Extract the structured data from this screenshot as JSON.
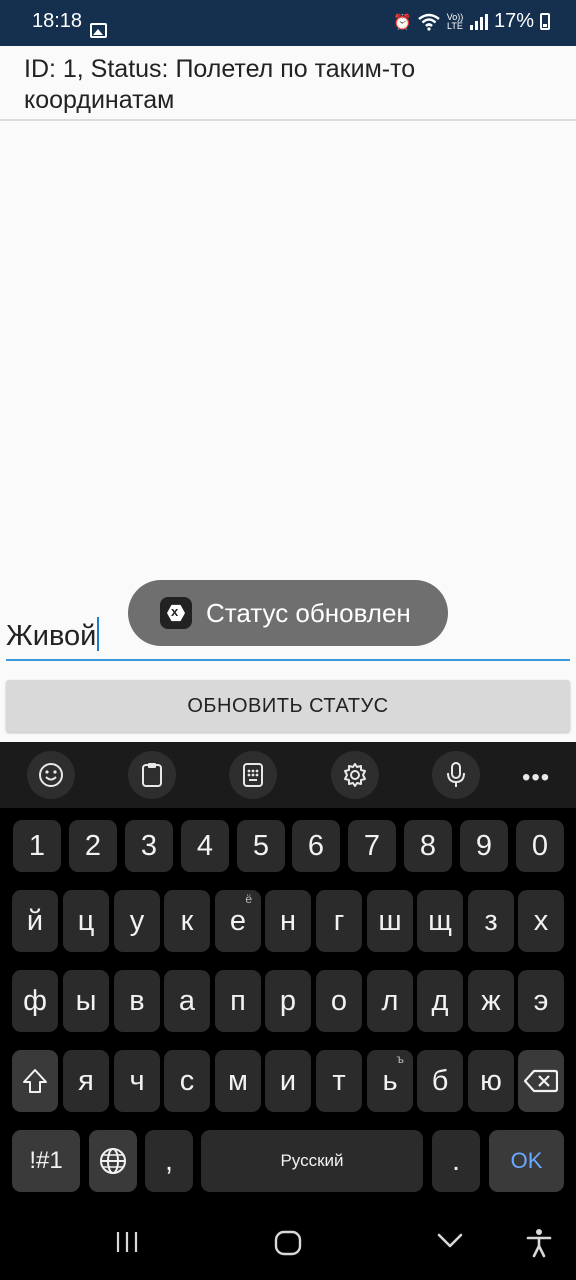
{
  "status_bar": {
    "time": "18:18",
    "volte_label": "Vo)) LTE",
    "battery": "17%"
  },
  "content": {
    "status_line": "ID: 1, Status: Полетел по таким-то координатам",
    "entry_value": "Живой",
    "update_button": "ОБНОВИТЬ СТАТУС",
    "toast_text": "Статус обновлен"
  },
  "keyboard": {
    "toolbar": [
      "emoji-icon",
      "clipboard-icon",
      "keypad-icon",
      "gear-icon",
      "microphone-icon",
      "more-icon"
    ],
    "row_numbers": [
      "1",
      "2",
      "3",
      "4",
      "5",
      "6",
      "7",
      "8",
      "9",
      "0"
    ],
    "row1": [
      "й",
      "ц",
      "у",
      "к",
      "е",
      "н",
      "г",
      "ш",
      "щ",
      "з",
      "х"
    ],
    "row1_alt_e": "ё",
    "row2": [
      "ф",
      "ы",
      "в",
      "а",
      "п",
      "р",
      "о",
      "л",
      "д",
      "ж",
      "э"
    ],
    "row3": [
      "я",
      "ч",
      "с",
      "м",
      "и",
      "т",
      "ь",
      "б",
      "ю"
    ],
    "row3_alt_soft": "ъ",
    "symbols": "!#1",
    "comma": ",",
    "space": "Русский",
    "period": ".",
    "ok": "OK"
  },
  "colors": {
    "status_bar_bg": "#15304f",
    "accent_underline": "#3a9ad9",
    "ok_text": "#6aa9ff"
  }
}
